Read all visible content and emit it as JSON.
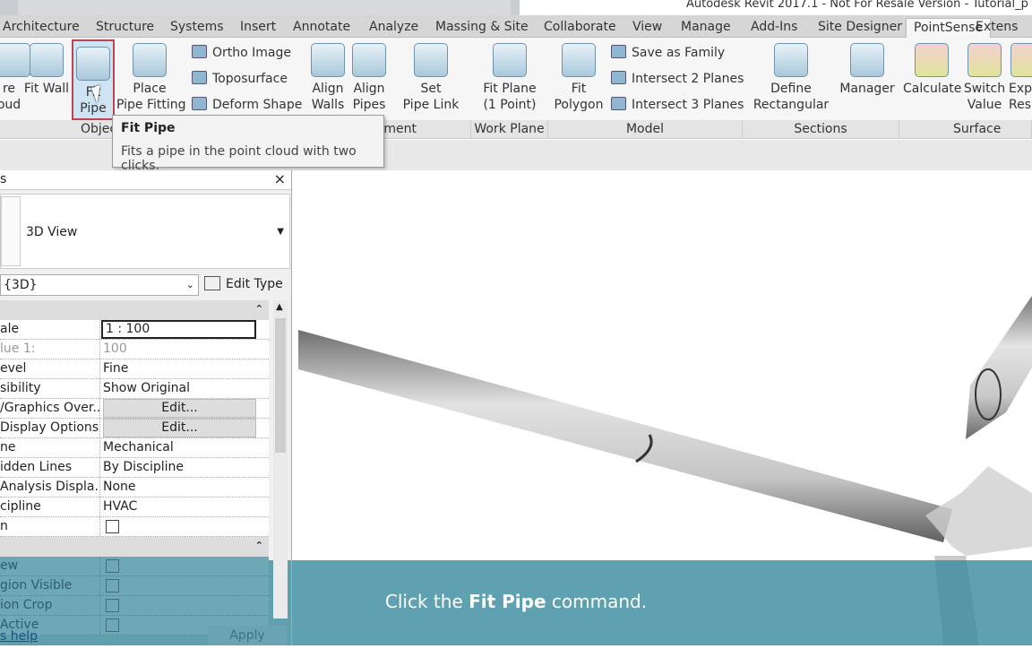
{
  "window": {
    "title": "Autodesk Revit 2017.1 - Not For Resale Version -    Tutorial_p"
  },
  "tabs": [
    "Architecture",
    "Structure",
    "Systems",
    "Insert",
    "Annotate",
    "Analyze",
    "Massing & Site",
    "Collaborate",
    "View",
    "Manage",
    "Add-Ins",
    "Site Designer",
    "PointSense",
    "Extens"
  ],
  "active_tab": "PointSense",
  "ribbon": {
    "buttons": {
      "cloud": "re\noud",
      "fit_wall": "Fit Wall",
      "fit_pipe": "Fit\nPipe",
      "place_fitting": "Place\nPipe Fitting",
      "align_walls": "Align\nWalls",
      "align_pipes": "Align\nPipes",
      "set_pipe_link": "Set\nPipe Link",
      "fit_plane": "Fit Plane\n(1 Point)",
      "fit_polygon": "Fit\nPolygon",
      "define_rect": "Define\nRectangular",
      "manager": "Manager",
      "calculate": "Calculate",
      "switch_value": "Switch\nValue",
      "export": "Exp\nResu"
    },
    "small": {
      "ortho": "Ortho Image",
      "topo": "Toposurface",
      "deform": "Deform Shape",
      "save_family": "Save as Family",
      "int2": "Intersect 2 Planes",
      "int3": "Intersect 3 Planes"
    },
    "panels": {
      "objects": "Objec",
      "alignment": "ment",
      "work_plane": "Work Plane",
      "model": "Model",
      "sections": "Sections",
      "surface": "Surface Analy"
    }
  },
  "tooltip": {
    "title": "Fit Pipe",
    "text": "Fits a pipe in the point cloud with two clicks."
  },
  "properties": {
    "header": "s",
    "close": "×",
    "type_name": "3D View",
    "instance": "{3D}",
    "edit_type": "Edit Type",
    "rows": [
      {
        "k": "ale",
        "v": "1 : 100"
      },
      {
        "k": "lue    1:",
        "v": "100"
      },
      {
        "k": "evel",
        "v": "Fine"
      },
      {
        "k": "sibility",
        "v": "Show Original"
      },
      {
        "k": "/Graphics Over...",
        "v": "Edit..."
      },
      {
        "k": " Display Options",
        "v": "Edit..."
      },
      {
        "k": "ne",
        "v": "Mechanical"
      },
      {
        "k": "idden Lines",
        "v": "By Discipline"
      },
      {
        "k": "Analysis Displa...",
        "v": "None"
      },
      {
        "k": "cipline",
        "v": "HVAC"
      },
      {
        "k": "n",
        "v": ""
      }
    ],
    "rows2": [
      {
        "k": "ew"
      },
      {
        "k": "gion Visible"
      },
      {
        "k": "ion Crop"
      },
      {
        "k": "Active"
      }
    ],
    "help": "s help",
    "apply": "Apply"
  },
  "caption": {
    "pre": "Click the ",
    "bold": "Fit Pipe",
    "post": " command."
  }
}
